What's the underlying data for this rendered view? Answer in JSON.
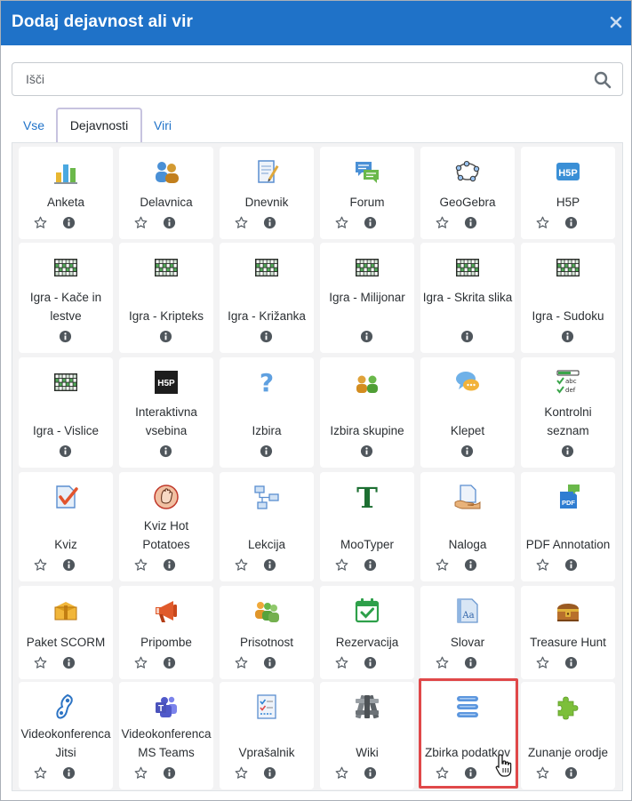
{
  "dialog": {
    "title": "Dodaj dejavnost ali vir"
  },
  "search": {
    "placeholder": "Išči",
    "value": ""
  },
  "tabs": [
    {
      "label": "Vse",
      "active": false
    },
    {
      "label": "Dejavnosti",
      "active": true
    },
    {
      "label": "Viri",
      "active": false
    }
  ],
  "colors": {
    "header": "#1f72c8",
    "link": "#1f72c8",
    "highlight": "#e04849"
  },
  "tiles": [
    {
      "label": "Anketa",
      "icon": "bar-chart-icon",
      "star": true
    },
    {
      "label": "Delavnica",
      "icon": "workshop-icon",
      "star": true
    },
    {
      "label": "Dnevnik",
      "icon": "journal-icon",
      "star": true
    },
    {
      "label": "Forum",
      "icon": "forum-icon",
      "star": true
    },
    {
      "label": "GeoGebra",
      "icon": "geogebra-icon",
      "star": true
    },
    {
      "label": "H5P",
      "icon": "h5p-icon",
      "star": true
    },
    {
      "label": "Igra - Kače in lestve",
      "icon": "game-grid-icon",
      "star": false
    },
    {
      "label": "Igra - Kripteks",
      "icon": "game-grid-icon",
      "star": false
    },
    {
      "label": "Igra - Križanka",
      "icon": "game-grid-icon",
      "star": false
    },
    {
      "label": "Igra - Milijonar",
      "icon": "game-grid-icon",
      "star": false
    },
    {
      "label": "Igra - Skrita slika",
      "icon": "game-grid-icon",
      "star": false
    },
    {
      "label": "Igra - Sudoku",
      "icon": "game-grid-icon",
      "star": false
    },
    {
      "label": "Igra - Vislice",
      "icon": "game-grid-icon",
      "star": false
    },
    {
      "label": "Interaktivna vsebina",
      "icon": "h5p-dark-icon",
      "star": false
    },
    {
      "label": "Izbira",
      "icon": "question-icon",
      "star": false
    },
    {
      "label": "Izbira skupine",
      "icon": "group-choice-icon",
      "star": false
    },
    {
      "label": "Klepet",
      "icon": "chat-icon",
      "star": false
    },
    {
      "label": "Kontrolni seznam",
      "icon": "checklist-icon",
      "star": false
    },
    {
      "label": "Kviz",
      "icon": "quiz-icon",
      "star": true
    },
    {
      "label": "Kviz Hot Potatoes",
      "icon": "hot-potatoes-icon",
      "star": true
    },
    {
      "label": "Lekcija",
      "icon": "lesson-icon",
      "star": true
    },
    {
      "label": "MooTyper",
      "icon": "mootyper-icon",
      "star": true
    },
    {
      "label": "Naloga",
      "icon": "assignment-icon",
      "star": true
    },
    {
      "label": "PDF Annotation",
      "icon": "pdf-annotation-icon",
      "star": true
    },
    {
      "label": "Paket SCORM",
      "icon": "scorm-icon",
      "star": true
    },
    {
      "label": "Pripombe",
      "icon": "megaphone-icon",
      "star": true
    },
    {
      "label": "Prisotnost",
      "icon": "attendance-icon",
      "star": true
    },
    {
      "label": "Rezervacija",
      "icon": "calendar-check-icon",
      "star": true
    },
    {
      "label": "Slovar",
      "icon": "glossary-icon",
      "star": true
    },
    {
      "label": "Treasure Hunt",
      "icon": "treasure-chest-icon",
      "star": true
    },
    {
      "label": "Videokonferenca Jitsi",
      "icon": "jitsi-icon",
      "star": true
    },
    {
      "label": "Videokonferenca MS Teams",
      "icon": "teams-icon",
      "star": true
    },
    {
      "label": "Vprašalnik",
      "icon": "questionnaire-icon",
      "star": true
    },
    {
      "label": "Wiki",
      "icon": "wiki-icon",
      "star": true
    },
    {
      "label": "Zbirka podatkov",
      "icon": "database-icon",
      "star": true,
      "highlighted": true
    },
    {
      "label": "Zunanje orodje",
      "icon": "puzzle-icon",
      "star": true
    }
  ]
}
